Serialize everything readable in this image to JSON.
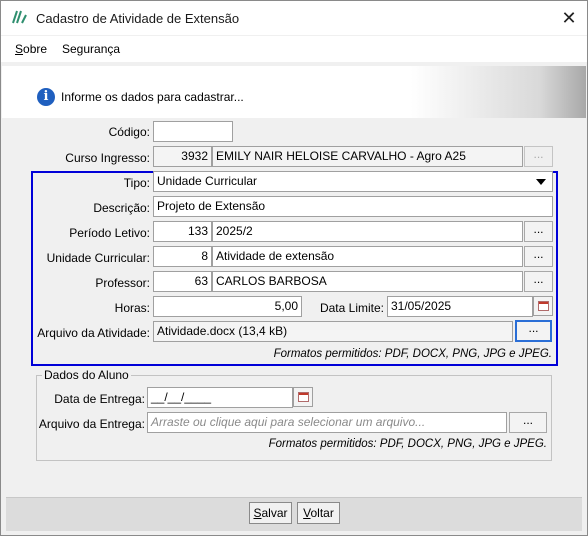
{
  "window": {
    "title": "Cadastro de Atividade de Extensão",
    "close_glyph": "✕"
  },
  "menu": {
    "items": [
      {
        "label": "Sobre",
        "underline": "S",
        "rest": "obre"
      },
      {
        "label": "Segurança"
      }
    ]
  },
  "info": {
    "text": "Informe os dados para cadastrar..."
  },
  "form": {
    "codigo": {
      "label": "Código:",
      "value": ""
    },
    "curso": {
      "label": "Curso Ingresso:",
      "code": "3932",
      "name": "EMILY NAIR HELOISE CARVALHO - Agro A25"
    },
    "tipo": {
      "label": "Tipo:",
      "value": "Unidade Curricular"
    },
    "descricao": {
      "label": "Descrição:",
      "value": "Projeto de Extensão"
    },
    "periodo": {
      "label": "Período Letivo:",
      "code": "133",
      "name": "2025/2"
    },
    "unidade": {
      "label": "Unidade Curricular:",
      "code": "8",
      "name": "Atividade de extensão"
    },
    "professor": {
      "label": "Professor:",
      "code": "63",
      "name": "CARLOS BARBOSA"
    },
    "horas": {
      "label": "Horas:",
      "value": "5,00"
    },
    "data_limite": {
      "label": "Data Limite:",
      "value": "31/05/2025"
    },
    "arquivo": {
      "label": "Arquivo da Atividade:",
      "value": "Atividade.docx (13,4 kB)"
    },
    "formatos": "Formatos permitidos: PDF, DOCX, PNG, JPG e JPEG."
  },
  "aluno": {
    "title": "Dados do Aluno",
    "data_entrega": {
      "label": "Data de Entrega:",
      "value": "__/__/____"
    },
    "arquivo_entrega": {
      "label": "Arquivo da Entrega:",
      "placeholder": "Arraste ou clique aqui para selecionar um arquivo..."
    },
    "formatos": "Formatos permitidos: PDF, DOCX, PNG, JPG e JPEG."
  },
  "buttons": {
    "dots": "...",
    "salvar": {
      "underline": "S",
      "rest": "alvar"
    },
    "voltar": {
      "underline": "V",
      "rest": "oltar"
    }
  },
  "colors": {
    "highlight_frame": "#0000d8",
    "info_icon": "#1f5fbf"
  }
}
